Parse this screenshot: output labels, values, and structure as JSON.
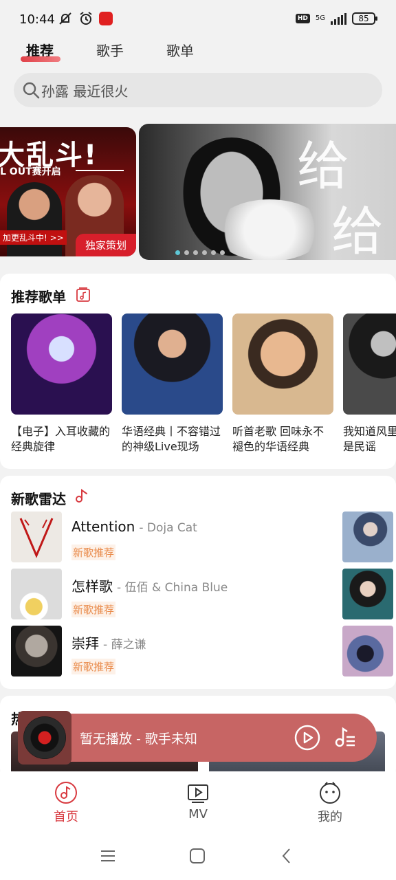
{
  "status_bar": {
    "time": "10:44",
    "network": "5G",
    "hd": "HD",
    "battery": "85"
  },
  "tabs": [
    {
      "label": "推荐",
      "active": true
    },
    {
      "label": "歌手",
      "active": false
    },
    {
      "label": "歌单",
      "active": false
    }
  ],
  "search": {
    "placeholder": "孙露 最近很火"
  },
  "banner": {
    "left": {
      "headline": "大乱斗!",
      "subline": "L OUT赛开启",
      "link": "加更乱斗中! >>",
      "tag": "独家策划"
    },
    "main": {
      "calligraphy_1": "给",
      "calligraphy_2": "给"
    },
    "dots_count": 6,
    "active_dot": 0
  },
  "recommended_playlists": {
    "title": "推荐歌单",
    "items": [
      {
        "text": "【电子】入耳收藏的经典旋律"
      },
      {
        "text": "华语经典丨不容错过的神级Live现场"
      },
      {
        "text": "听首老歌 回味永不褪色的华语经典"
      },
      {
        "text": "我知道风里有诗,那正是民谣"
      }
    ]
  },
  "new_songs": {
    "title": "新歌雷达",
    "songs": [
      {
        "title": "Attention",
        "artist": "- Doja Cat",
        "tag": "新歌推荐"
      },
      {
        "title": "怎样歌",
        "artist": "- 伍佰 & China Blue",
        "tag": "新歌推荐"
      },
      {
        "title": "崇拜",
        "artist": "- 薛之谦",
        "tag": "新歌推荐"
      }
    ]
  },
  "hot_section": {
    "title": "热门"
  },
  "player": {
    "now_playing": "暂无播放 - 歌手未知"
  },
  "bottom_nav": [
    {
      "label": "首页",
      "active": true
    },
    {
      "label": "MV",
      "active": false
    },
    {
      "label": "我的",
      "active": false
    }
  ],
  "colors": {
    "accent": "#d83a40",
    "player_bg": "#c76564",
    "tag": "#e98a4a"
  }
}
